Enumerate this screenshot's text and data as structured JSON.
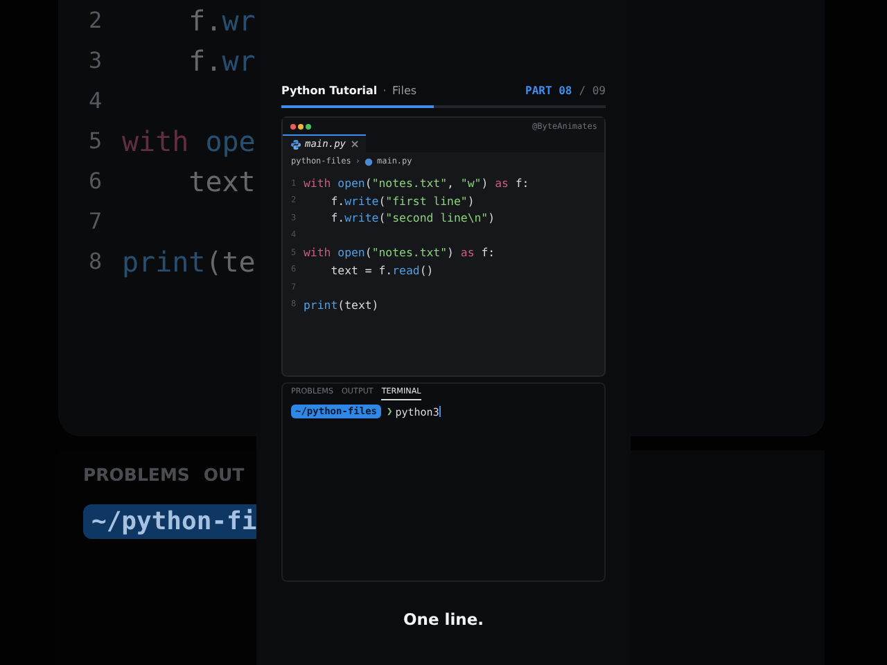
{
  "backdrop": {
    "code_lines": [
      {
        "number": "2",
        "tokens": [
          {
            "text": "    f.",
            "kind": "plain"
          },
          {
            "text": "wr",
            "kind": "fn"
          }
        ]
      },
      {
        "number": "3",
        "tokens": [
          {
            "text": "    f.",
            "kind": "plain"
          },
          {
            "text": "wr",
            "kind": "fn"
          }
        ]
      },
      {
        "number": "4"
      },
      {
        "number": "5",
        "tokens": [
          {
            "text": "with",
            "kind": "kw"
          },
          {
            "text": " ope",
            "kind": "fn"
          }
        ]
      },
      {
        "number": "6",
        "tokens": [
          {
            "text": "    text",
            "kind": "plain"
          }
        ]
      },
      {
        "number": "7"
      },
      {
        "number": "8",
        "tokens": [
          {
            "text": "print",
            "kind": "fn"
          },
          {
            "text": "(te",
            "kind": "plain"
          }
        ]
      }
    ],
    "panel_tabs": [
      "PROBLEMS",
      "OUT"
    ],
    "prompt": "~/python-fi"
  },
  "header": {
    "title": "Python Tutorial",
    "separator": "·",
    "subtitle": "Files",
    "part_label": "PART 08",
    "part_total": "/ 09",
    "progress": {
      "level": 0.47
    }
  },
  "editor": {
    "handle": "@ByteAnimates",
    "tabs": [
      {
        "label": "main.py",
        "selected": true
      }
    ],
    "breadcrumb": [
      "python-files",
      "main.py"
    ],
    "breadcrumb_separator": "›",
    "code_lines": [
      {
        "number": "1",
        "tokens": [
          {
            "text": "with",
            "kind": "kw"
          },
          {
            "text": " open",
            "kind": "fn"
          },
          {
            "text": "(",
            "kind": "plain"
          },
          {
            "text": "\"notes.txt\"",
            "kind": "str"
          },
          {
            "text": ", ",
            "kind": "plain"
          },
          {
            "text": "\"w\"",
            "kind": "str"
          },
          {
            "text": ") ",
            "kind": "plain"
          },
          {
            "text": "as",
            "kind": "kw"
          },
          {
            "text": " f:",
            "kind": "plain"
          }
        ]
      },
      {
        "number": "2",
        "tokens": [
          {
            "text": "    f.",
            "kind": "plain"
          },
          {
            "text": "write",
            "kind": "fn"
          },
          {
            "text": "(",
            "kind": "plain"
          },
          {
            "text": "\"first line\"",
            "kind": "str"
          },
          {
            "text": ")",
            "kind": "plain"
          }
        ]
      },
      {
        "number": "3",
        "tokens": [
          {
            "text": "    f.",
            "kind": "plain"
          },
          {
            "text": "write",
            "kind": "fn"
          },
          {
            "text": "(",
            "kind": "plain"
          },
          {
            "text": "\"second line\\n\"",
            "kind": "str"
          },
          {
            "text": ")",
            "kind": "plain"
          }
        ]
      },
      {
        "number": "4"
      },
      {
        "number": "5",
        "tokens": [
          {
            "text": "with",
            "kind": "kw"
          },
          {
            "text": " open",
            "kind": "fn"
          },
          {
            "text": "(",
            "kind": "plain"
          },
          {
            "text": "\"notes.txt\"",
            "kind": "str"
          },
          {
            "text": ") ",
            "kind": "plain"
          },
          {
            "text": "as",
            "kind": "kw"
          },
          {
            "text": " f:",
            "kind": "plain"
          }
        ]
      },
      {
        "number": "6",
        "tokens": [
          {
            "text": "    text = f.",
            "kind": "plain"
          },
          {
            "text": "read",
            "kind": "fn"
          },
          {
            "text": "()",
            "kind": "plain"
          }
        ]
      },
      {
        "number": "7"
      },
      {
        "number": "8",
        "tokens": [
          {
            "text": "print",
            "kind": "fn"
          },
          {
            "text": "(text)",
            "kind": "plain"
          }
        ]
      }
    ]
  },
  "terminal": {
    "tabs": [
      {
        "label": "PROBLEMS",
        "selected": false
      },
      {
        "label": "OUTPUT",
        "selected": false
      },
      {
        "label": "TERMINAL",
        "selected": true
      }
    ],
    "prompt": {
      "directory": "~/python-files",
      "symbol": "❯",
      "command": "python3"
    }
  },
  "caption": "One line."
}
